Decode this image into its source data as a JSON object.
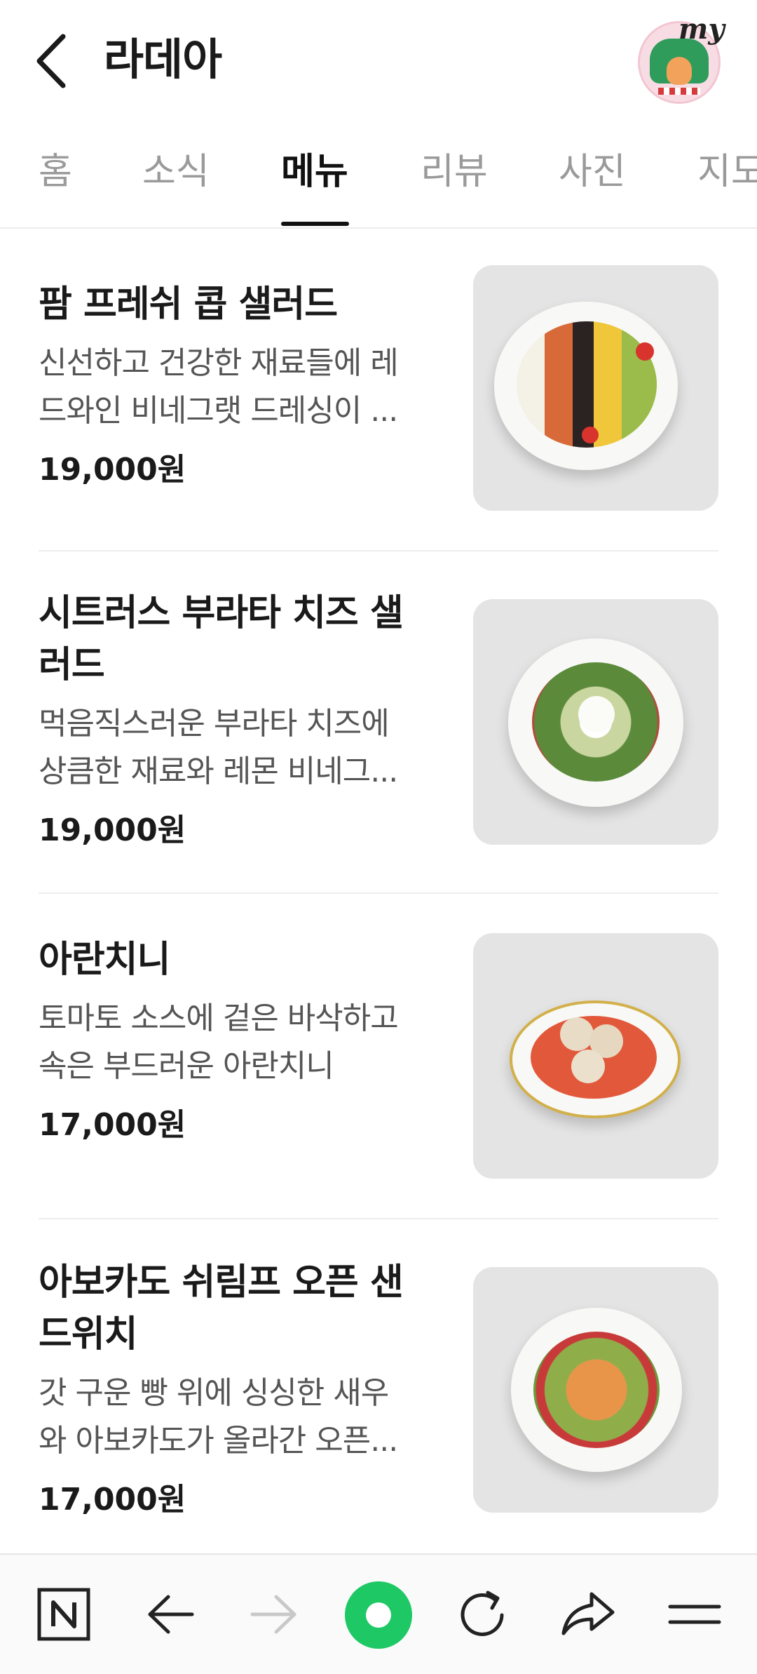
{
  "header": {
    "title": "라데아",
    "my_badge": "my"
  },
  "tabs": [
    {
      "label": "홈",
      "active": false
    },
    {
      "label": "소식",
      "active": false
    },
    {
      "label": "메뉴",
      "active": true
    },
    {
      "label": "리뷰",
      "active": false
    },
    {
      "label": "사진",
      "active": false
    },
    {
      "label": "지도",
      "active": false
    }
  ],
  "menu": [
    {
      "name": "팜 프레쉬 콥 샐러드",
      "desc_lines": [
        "신선하고 건강한 재료들에 레",
        "드와인 비네그랫 드레싱이 ..."
      ],
      "price": "19,000원",
      "photo_icon": "cobb-salad-photo"
    },
    {
      "name_lines": [
        "시트러스 부라타 치즈 샐",
        "러드"
      ],
      "desc_lines": [
        "먹음직스러운 부라타 치즈에",
        "상큼한 재료와 레몬 비네그..."
      ],
      "price": "19,000원",
      "photo_icon": "burrata-salad-photo"
    },
    {
      "name": "아란치니",
      "desc_lines": [
        "토마토 소스에 겉은 바삭하고",
        "속은 부드러운 아란치니"
      ],
      "price": "17,000원",
      "photo_icon": "arancini-photo"
    },
    {
      "name_lines": [
        "아보카도 쉬림프 오픈 샌",
        "드위치"
      ],
      "desc_lines": [
        "갓 구운 빵 위에 싱싱한 새우",
        "와 아보카도가 올라간 오픈..."
      ],
      "price": "17,000원",
      "photo_icon": "shrimp-sandwich-photo"
    }
  ],
  "bottom_bar": {
    "icons": [
      "naver-n-icon",
      "back-arrow-icon",
      "forward-arrow-icon",
      "home-green-icon",
      "refresh-icon",
      "share-icon",
      "menu-icon"
    ],
    "colors": {
      "accent_green": "#1ec800",
      "active_text": "#111111",
      "inactive_text": "#9a9a9a"
    }
  }
}
